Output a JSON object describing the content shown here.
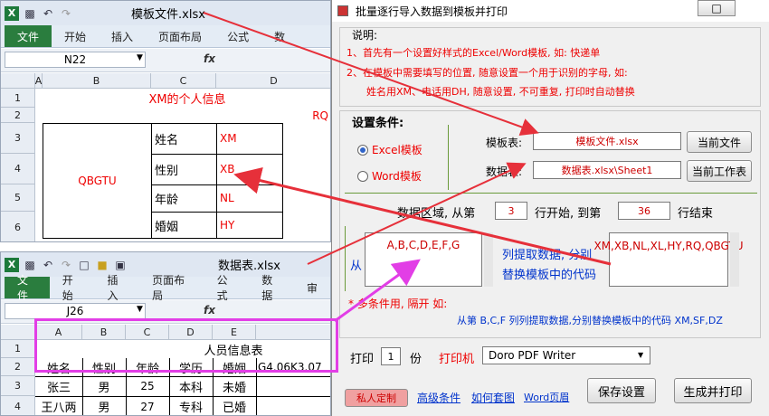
{
  "win1": {
    "title": "模板文件.xlsx",
    "tabs": [
      "文件",
      "开始",
      "插入",
      "页面布局",
      "公式",
      "数"
    ],
    "namebox": "N22",
    "fx": "fx",
    "cols": [
      "A",
      "B",
      "C",
      "D"
    ],
    "rows": [
      "1",
      "2",
      "3",
      "4",
      "5",
      "6"
    ],
    "title_cell": "XM的个人信息",
    "rq": "RQ",
    "photo_code": "QBGTU",
    "labels": [
      "姓名",
      "性别",
      "年龄",
      "婚姻"
    ],
    "codes": [
      "XM",
      "XB",
      "NL",
      "HY"
    ]
  },
  "win2": {
    "title": "数据表.xlsx",
    "tabs": [
      "文件",
      "开始",
      "插入",
      "页面布局",
      "公式",
      "数据",
      "审"
    ],
    "namebox": "J26",
    "fx": "fx",
    "cols": [
      "A",
      "B",
      "C",
      "D",
      "E"
    ],
    "rows": [
      "1",
      "2",
      "3",
      "4"
    ],
    "header": "人员信息表",
    "headers": [
      "姓名",
      "性别",
      "年龄",
      "学历",
      "婚姻"
    ],
    "extra": "G4.06K3.07",
    "data": [
      [
        "张三",
        "男",
        "25",
        "本科",
        "未婚"
      ],
      [
        "王八两",
        "男",
        "27",
        "专科",
        "已婚"
      ]
    ]
  },
  "dialog": {
    "title": "批量逐行导入数据到模板并打印",
    "help_title": "说明:",
    "help1": "1、首先有一个设置好样式的Excel/Word模板, 如: 快递单",
    "help2": "2、在模板中需要填写的位置, 随意设置一个用于识别的字母, 如:",
    "help3": "姓名用XM、电话用DH, 随意设置, 不可重复, 打印时自动替换",
    "cond_title": "设置条件:",
    "radio_excel": "Excel模板",
    "radio_word": "Word模板",
    "tpl_label": "模板表:",
    "tpl_value": "模板文件.xlsx",
    "tpl_btn": "当前文件",
    "data_label": "数据表:",
    "data_value": "数据表.xlsx\\Sheet1",
    "data_btn": "当前工作表",
    "range_a": "数据区域, 从第",
    "range_start": "3",
    "range_b": "行开始, 到第",
    "range_end": "36",
    "range_c": "行结束",
    "from": "从",
    "cols_value": "A,B,C,D,E,F,G",
    "mid1": "列提取数据, 分别",
    "mid2": "替换模板中的代码",
    "codes_value": "XM,XB,NL,XL,HY,RQ,QBGTU",
    "multi_note": "* 多条件用, 隔开 如:",
    "example": "从第 B,C,F 列列提取数据,分别替换模板中的代码 XM,SF,DZ",
    "print_label": "打印",
    "copies": "1",
    "copies_unit": "份",
    "printer_label": "打印机",
    "printer": "Doro PDF Writer",
    "private_btn": "私人定制",
    "link1": "高级条件",
    "link2": "如何套图",
    "link3": "Word页眉",
    "save_btn": "保存设置",
    "print_btn": "生成并打印"
  }
}
